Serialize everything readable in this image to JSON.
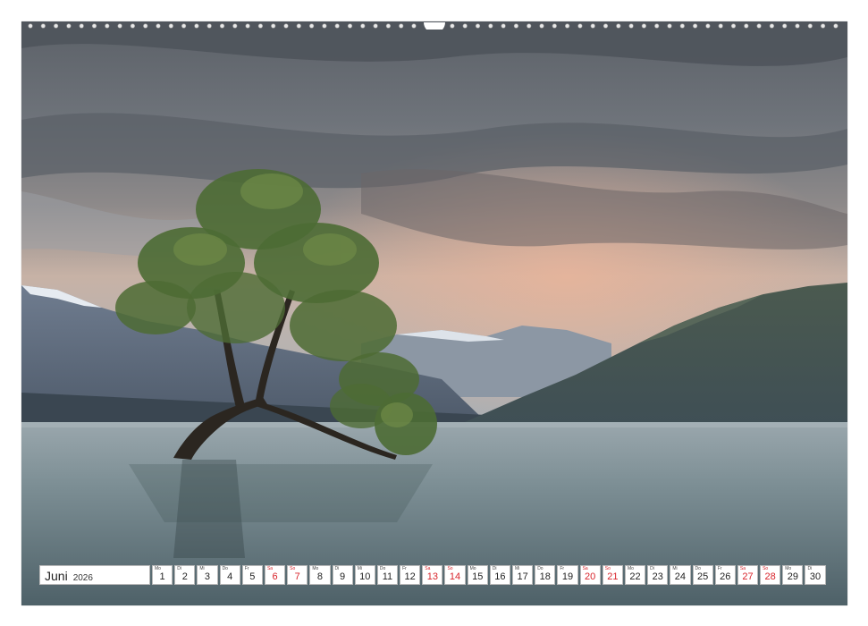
{
  "calendar": {
    "month": "Juni",
    "year": "2026",
    "days": [
      {
        "dow": "Mo",
        "num": "1",
        "weekend": false
      },
      {
        "dow": "Di",
        "num": "2",
        "weekend": false
      },
      {
        "dow": "Mi",
        "num": "3",
        "weekend": false
      },
      {
        "dow": "Do",
        "num": "4",
        "weekend": false
      },
      {
        "dow": "Fr",
        "num": "5",
        "weekend": false
      },
      {
        "dow": "Sa",
        "num": "6",
        "weekend": true
      },
      {
        "dow": "So",
        "num": "7",
        "weekend": true
      },
      {
        "dow": "Mo",
        "num": "8",
        "weekend": false
      },
      {
        "dow": "Di",
        "num": "9",
        "weekend": false
      },
      {
        "dow": "Mi",
        "num": "10",
        "weekend": false
      },
      {
        "dow": "Do",
        "num": "11",
        "weekend": false
      },
      {
        "dow": "Fr",
        "num": "12",
        "weekend": false
      },
      {
        "dow": "Sa",
        "num": "13",
        "weekend": true
      },
      {
        "dow": "So",
        "num": "14",
        "weekend": true
      },
      {
        "dow": "Mo",
        "num": "15",
        "weekend": false
      },
      {
        "dow": "Di",
        "num": "16",
        "weekend": false
      },
      {
        "dow": "Mi",
        "num": "17",
        "weekend": false
      },
      {
        "dow": "Do",
        "num": "18",
        "weekend": false
      },
      {
        "dow": "Fr",
        "num": "19",
        "weekend": false
      },
      {
        "dow": "Sa",
        "num": "20",
        "weekend": true
      },
      {
        "dow": "So",
        "num": "21",
        "weekend": true
      },
      {
        "dow": "Mo",
        "num": "22",
        "weekend": false
      },
      {
        "dow": "Di",
        "num": "23",
        "weekend": false
      },
      {
        "dow": "Mi",
        "num": "24",
        "weekend": false
      },
      {
        "dow": "Do",
        "num": "25",
        "weekend": false
      },
      {
        "dow": "Fr",
        "num": "26",
        "weekend": false
      },
      {
        "dow": "Sa",
        "num": "27",
        "weekend": true
      },
      {
        "dow": "So",
        "num": "28",
        "weekend": true
      },
      {
        "dow": "Mo",
        "num": "29",
        "weekend": false
      },
      {
        "dow": "Di",
        "num": "30",
        "weekend": false
      }
    ]
  },
  "colors": {
    "weekend": "#d8232a",
    "text": "#222222",
    "cell_border": "#b9b9b9"
  }
}
